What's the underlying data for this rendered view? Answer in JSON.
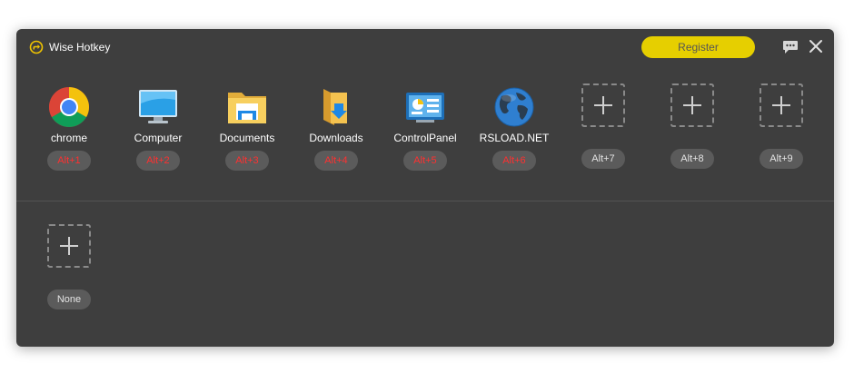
{
  "window": {
    "title": "Wise Hotkey",
    "register_label": "Register"
  },
  "apps": [
    {
      "name": "chrome",
      "hotkey": "Alt+1",
      "icon": "chrome-icon"
    },
    {
      "name": "Computer",
      "hotkey": "Alt+2",
      "icon": "computer-icon"
    },
    {
      "name": "Documents",
      "hotkey": "Alt+3",
      "icon": "documents-folder-icon"
    },
    {
      "name": "Downloads",
      "hotkey": "Alt+4",
      "icon": "downloads-folder-icon"
    },
    {
      "name": "ControlPanel",
      "hotkey": "Alt+5",
      "icon": "control-panel-icon"
    },
    {
      "name": "RSLOAD.NET",
      "hotkey": "Alt+6",
      "icon": "globe-icon"
    }
  ],
  "empty_slots": [
    {
      "hotkey": "Alt+7"
    },
    {
      "hotkey": "Alt+8"
    },
    {
      "hotkey": "Alt+9"
    }
  ],
  "second_row": [
    {
      "hotkey": "None"
    }
  ],
  "colors": {
    "window_bg": "#3e3e3e",
    "register_bg": "#e6cf00",
    "hotkey_assigned": "#ff3030",
    "hotkey_pill": "#5b5b5b"
  }
}
